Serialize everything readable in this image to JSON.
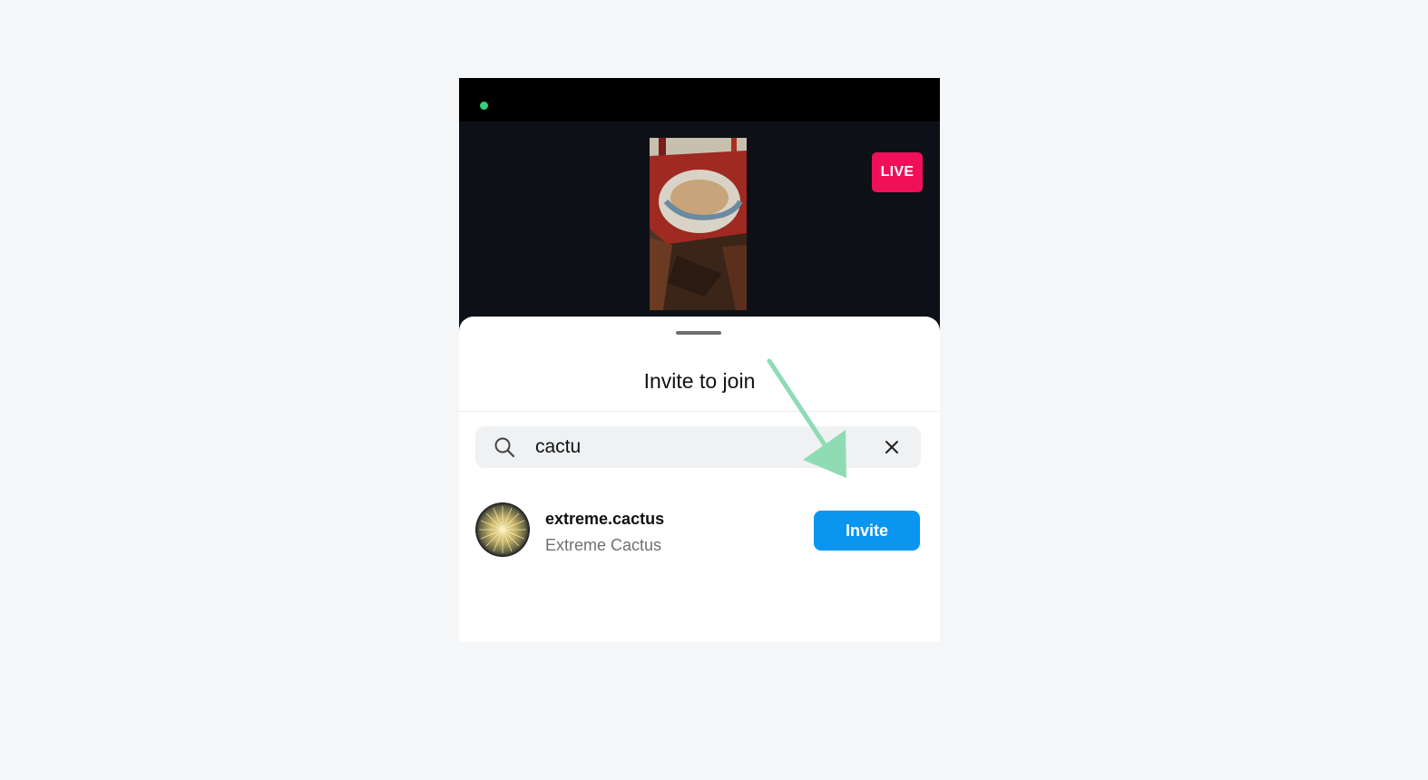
{
  "status_bar": {
    "indicator_color": "#2fd27a"
  },
  "live_badge": {
    "label": "LIVE",
    "color": "#f0105a"
  },
  "sheet": {
    "title": "Invite to join",
    "search": {
      "icon": "search-icon",
      "value": "cactu",
      "clear_icon": "close-icon"
    },
    "results": [
      {
        "username": "extreme.cactus",
        "full_name": "Extreme Cactus",
        "action_label": "Invite"
      }
    ]
  },
  "colors": {
    "accent": "#0a95f0",
    "live": "#f0105a",
    "annotation_arrow": "#8fdcb4"
  }
}
